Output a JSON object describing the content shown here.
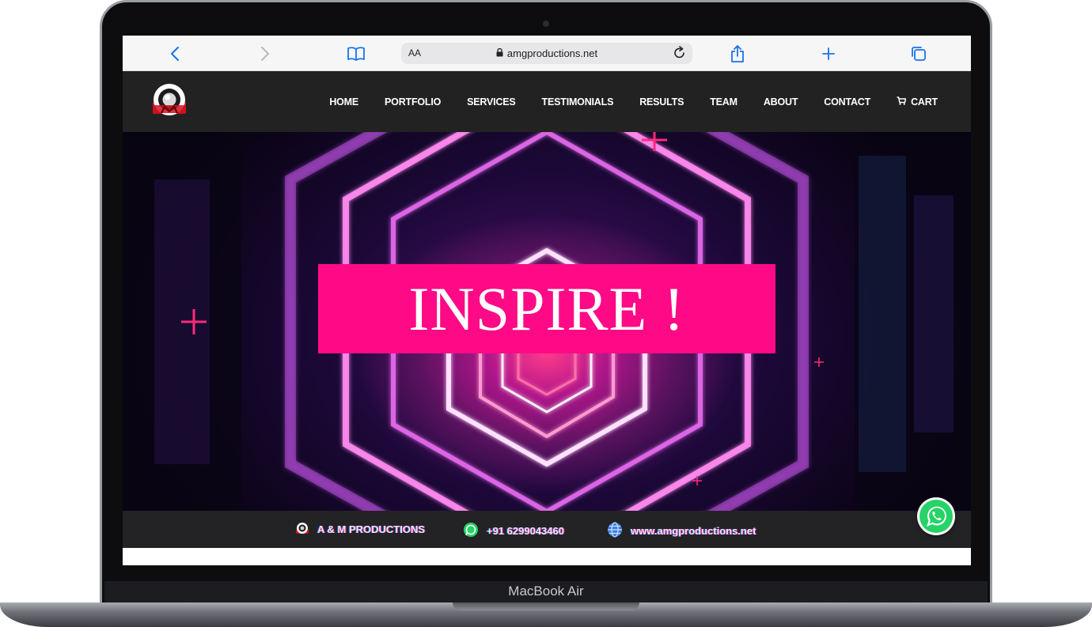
{
  "device": {
    "label": "MacBook Air"
  },
  "browser": {
    "text_size_label": "AA",
    "url": "amgproductions.net",
    "icons": [
      "back-icon",
      "forward-icon",
      "bookmarks-icon",
      "lock-icon",
      "reload-icon",
      "share-icon",
      "new-tab-icon",
      "tabs-icon"
    ]
  },
  "site": {
    "nav": {
      "items": [
        "HOME",
        "PORTFOLIO",
        "SERVICES",
        "TESTIMONIALS",
        "RESULTS",
        "TEAM",
        "ABOUT",
        "CONTACT"
      ],
      "cart_label": "CART"
    },
    "hero": {
      "headline": "INSPIRE !"
    },
    "contact_strip": {
      "brand": "A & M PRODUCTIONS",
      "phone": "+91 6299043460",
      "website": "www.amgproductions.net"
    }
  },
  "colors": {
    "accent_pink": "#ff0a86",
    "nav_bg": "#222222",
    "logo_red": "#d2101e",
    "whatsapp_green": "#25d366",
    "safari_blue": "#1a73e8"
  }
}
